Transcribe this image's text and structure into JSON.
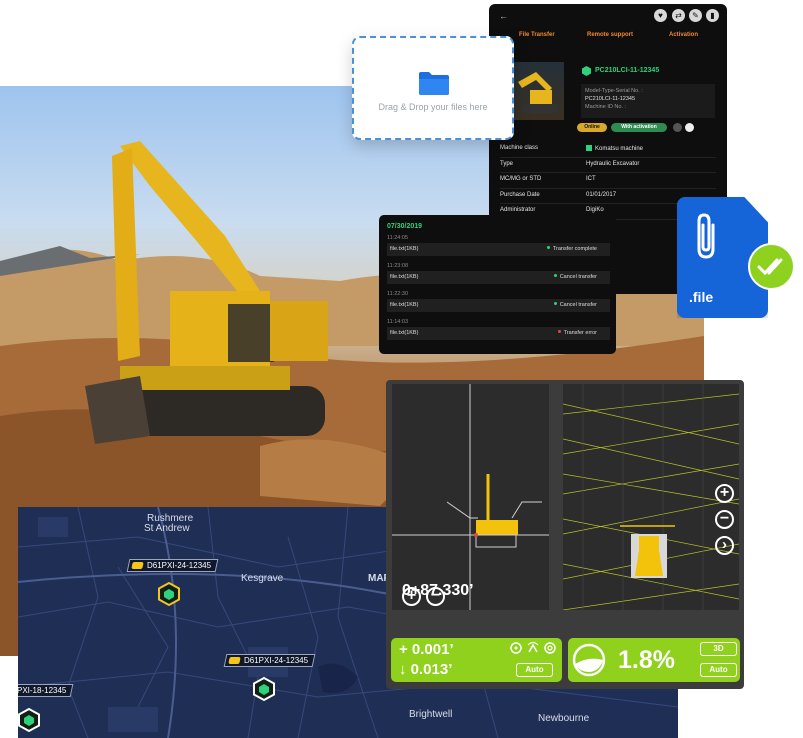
{
  "dropzone": {
    "text": "Drag & Drop your files here"
  },
  "machine_panel": {
    "back_glyph": "←",
    "toolbar_icons": [
      "heart-icon",
      "swap-icon",
      "pencil-icon",
      "trash-icon"
    ],
    "tabs": [
      "File Transfer",
      "Remote support",
      "Activation"
    ],
    "serial": "PC210LCI-11-12345",
    "info_lines": [
      "Model-Type-Serial No. :",
      "PC210LCI-11-12345",
      "Machine ID No. :"
    ],
    "status_pills": [
      "Online",
      "With activation"
    ],
    "rows": [
      {
        "key": "Machine class",
        "value": "Komatsu machine",
        "checked": true
      },
      {
        "key": "Type",
        "value": "Hydraulic Excavator"
      },
      {
        "key": "MC/MG or STD",
        "value": "ICT"
      },
      {
        "key": "Purchase Date",
        "value": "01/01/2017"
      },
      {
        "key": "Administrator",
        "value": "DigiKo"
      }
    ]
  },
  "transfer_log": {
    "date": "07/30/2019",
    "entries": [
      {
        "time": "11:24:05",
        "file": "file.txt(1KB)",
        "status": "Transfer complete",
        "status_color": "#2fd17c"
      },
      {
        "time": "11:23:08",
        "file": "file.txt(1KB)",
        "status": "Cancel transfer",
        "status_color": "#2fd17c"
      },
      {
        "time": "11:22:30",
        "file": "file.txt(1KB)",
        "status": "Cancel transfer",
        "status_color": "#2fd17c"
      },
      {
        "time": "11:14:03",
        "file": "file.txt(1KB)",
        "status": "Transfer error",
        "status_color": "#e04848"
      }
    ]
  },
  "file_badge": {
    "extension": ".file"
  },
  "map": {
    "places": [
      "Rushmere",
      "St Andrew",
      "Kesgrave",
      "MAR",
      "Brightwell",
      "Newbourne"
    ],
    "machines": [
      "D61PXI-24-12345",
      "D61PXI-24-12345",
      "PXI-18-12345"
    ]
  },
  "guidance": {
    "station": "0+87.330’",
    "zoom_in": "+",
    "zoom_out": "−",
    "right_controls": [
      "+",
      "−",
      "›"
    ],
    "cut_up": "+ 0.001’",
    "cut_down": "↓ 0.013’",
    "grade": "1.8%",
    "mode": "3D",
    "auto_label": "Auto"
  },
  "colors": {
    "accent_green": "#8fd11d",
    "status_green": "#2fd17c",
    "tab_orange": "#f28a2c",
    "file_blue": "#1565d8",
    "map_navy": "#1f2e55"
  }
}
